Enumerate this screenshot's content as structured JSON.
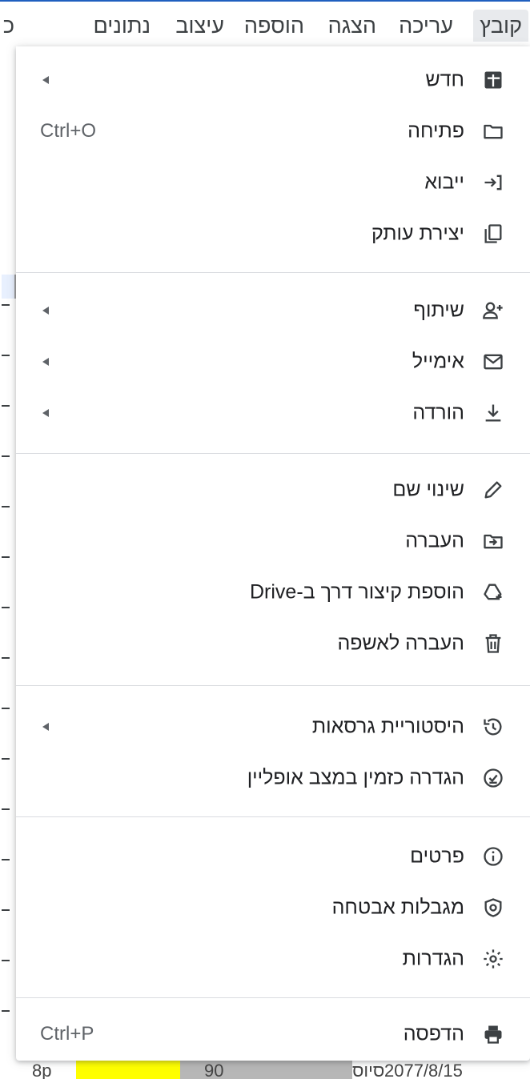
{
  "menubar": {
    "items": [
      {
        "label": "קובץ"
      },
      {
        "label": "עריכה"
      },
      {
        "label": "הצגה"
      },
      {
        "label": "הוספה"
      },
      {
        "label": "עיצוב"
      },
      {
        "label": "נתונים"
      },
      {
        "label": "כ"
      }
    ]
  },
  "menu": {
    "items": [
      {
        "label": "חדש",
        "icon": "new-sheet-icon",
        "submenu": true
      },
      {
        "label": "פתיחה",
        "icon": "folder-icon",
        "shortcut": "Ctrl+O"
      },
      {
        "label": "ייבוא",
        "icon": "import-icon"
      },
      {
        "label": "יצירת עותק",
        "icon": "copy-icon"
      },
      {
        "label": "שיתוף",
        "icon": "add-person-icon",
        "submenu": true
      },
      {
        "label": "אימייל",
        "icon": "mail-icon",
        "submenu": true
      },
      {
        "label": "הורדה",
        "icon": "download-icon",
        "submenu": true
      },
      {
        "label": "שינוי שם",
        "icon": "pencil-icon"
      },
      {
        "label": "העברה",
        "icon": "move-folder-icon"
      },
      {
        "label": "הוספת קיצור דרך ב-Drive",
        "icon": "drive-shortcut-icon"
      },
      {
        "label": "העברה לאשפה",
        "icon": "trash-icon"
      },
      {
        "label": "היסטוריית גרסאות",
        "icon": "history-icon",
        "submenu": true
      },
      {
        "label": "הגדרה כזמין במצב אופליין",
        "icon": "offline-icon"
      },
      {
        "label": "פרטים",
        "icon": "info-icon"
      },
      {
        "label": "מגבלות אבטחה",
        "icon": "security-icon"
      },
      {
        "label": "הגדרות",
        "icon": "gear-icon"
      },
      {
        "label": "הדפסה",
        "icon": "printer-icon",
        "shortcut": "Ctrl+P"
      }
    ]
  },
  "background": {
    "bottom_row": [
      "8p",
      "90",
      "סיוס",
      "2077/8/15"
    ]
  }
}
